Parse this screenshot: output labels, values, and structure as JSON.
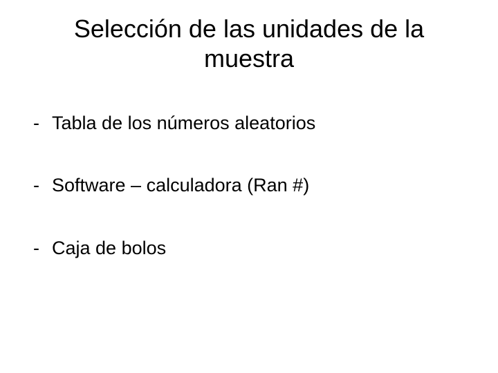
{
  "title": "Selección de las unidades de la muestra",
  "bullets": [
    {
      "marker": "-",
      "text": "Tabla de los números aleatorios"
    },
    {
      "marker": "-",
      "text": "Software – calculadora (Ran #)"
    },
    {
      "marker": "-",
      "text": "Caja de bolos"
    }
  ]
}
